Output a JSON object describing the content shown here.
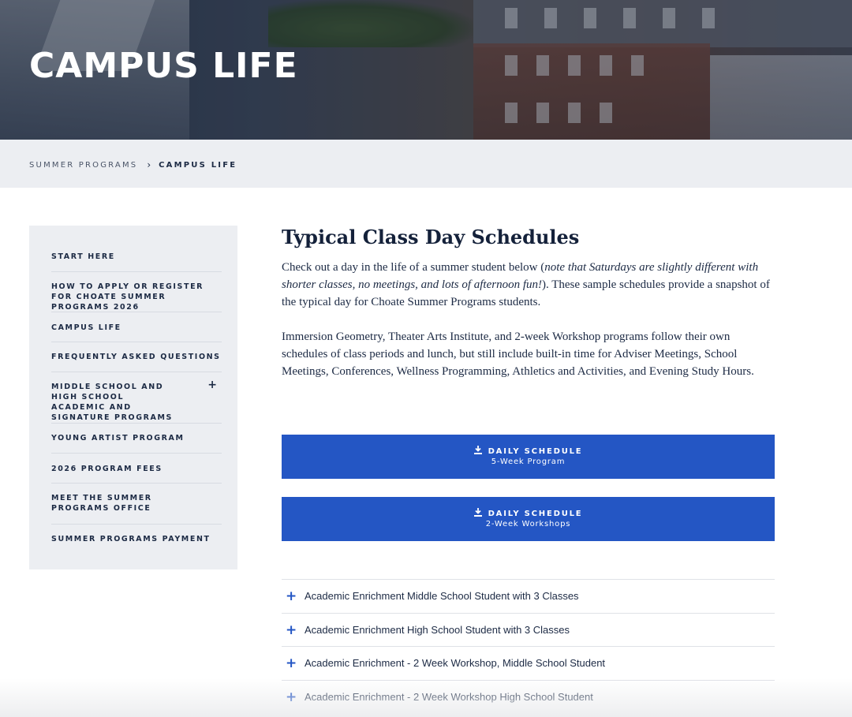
{
  "hero": {
    "title": "CAMPUS LIFE"
  },
  "breadcrumb": {
    "items": [
      "SUMMER PROGRAMS",
      "CAMPUS LIFE"
    ],
    "separator": "›"
  },
  "sidebar": {
    "items": [
      {
        "label": "START HERE"
      },
      {
        "label": "HOW TO APPLY OR REGISTER FOR CHOATE SUMMER PROGRAMS 2026"
      },
      {
        "label": "CAMPUS LIFE"
      },
      {
        "label": "FREQUENTLY ASKED QUESTIONS"
      },
      {
        "label": "MIDDLE SCHOOL AND HIGH SCHOOL ACADEMIC AND SIGNATURE PROGRAMS",
        "expand": "+"
      },
      {
        "label": "YOUNG ARTIST PROGRAM"
      },
      {
        "label": "2026 PROGRAM FEES"
      },
      {
        "label": "MEET THE SUMMER PROGRAMS OFFICE"
      },
      {
        "label": "SUMMER PROGRAMS PAYMENT"
      }
    ]
  },
  "main": {
    "heading": "Typical Class Day Schedules",
    "para1": {
      "before": "Check out a day in the life of a summer student below (",
      "italic": "note that Saturdays are slightly different with shorter classes, no meetings, and lots of afternoon fun!",
      "after": "). These sample schedules provide a snapshot of the typical day for Choate Summer Programs students."
    },
    "para2": "Immersion Geometry, Theater Arts Institute, and 2-week Workshop programs follow their own schedules of class periods and lunch, but still include built-in time for Adviser Meetings, School Meetings, Conferences, Wellness Programming, Athletics and Activities, and Evening Study Hours.",
    "buttons": [
      {
        "title": "DAILY SCHEDULE",
        "subtitle": "5-Week Program"
      },
      {
        "title": "DAILY SCHEDULE",
        "subtitle": "2-Week Workshops"
      }
    ],
    "accordion": [
      {
        "icon": "+",
        "label": "Academic Enrichment Middle School Student with 3 Classes"
      },
      {
        "icon": "+",
        "label": "Academic Enrichment High School Student with 3 Classes"
      },
      {
        "icon": "+",
        "label": "Academic Enrichment - 2 Week Workshop, Middle School Student"
      },
      {
        "icon": "+",
        "label": "Academic Enrichment - 2 Week Workshop High School Student"
      }
    ]
  },
  "colors": {
    "accent": "#2456c4",
    "navy": "#1c2a44",
    "panel": "#eceef2"
  },
  "icons": [
    "download-icon",
    "plus-icon",
    "chevron-right-icon"
  ]
}
